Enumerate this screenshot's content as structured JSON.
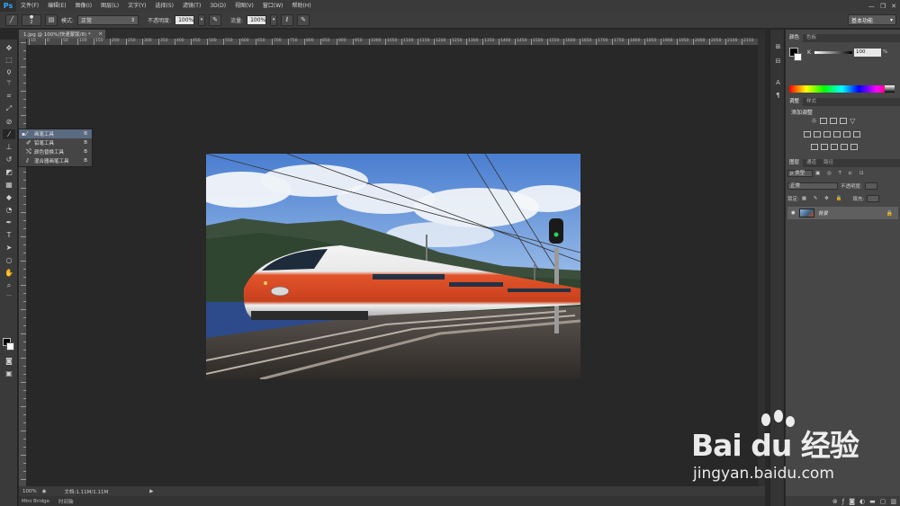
{
  "app": {
    "logo": "Ps"
  },
  "menu": [
    "文件(F)",
    "编辑(E)",
    "图像(I)",
    "图层(L)",
    "文字(Y)",
    "选择(S)",
    "滤镜(T)",
    "3D(D)",
    "视图(V)",
    "窗口(W)",
    "帮助(H)"
  ],
  "window_controls": {
    "minimize": "—",
    "restore": "❐",
    "close": "✕"
  },
  "options": {
    "brush_size": "2",
    "mode_label": "模式:",
    "mode_value": "正常",
    "opacity_label": "不透明度:",
    "opacity_value": "100%",
    "flow_label": "流量:",
    "flow_value": "100%"
  },
  "workspace": "基本功能",
  "document": {
    "tab_title": "1.jpg @ 100%(快速蒙版/8) *",
    "close": "×"
  },
  "ruler_labels": [
    "10",
    "0",
    "50",
    "100",
    "150",
    "200",
    "250",
    "300",
    "350",
    "400",
    "450",
    "500",
    "550",
    "600",
    "650",
    "700",
    "750",
    "800",
    "850",
    "900",
    "950",
    "1000",
    "1050",
    "1100",
    "1150",
    "1200",
    "1250",
    "1300",
    "1350",
    "1400",
    "1450",
    "1500",
    "1550",
    "1600",
    "1650",
    "1700",
    "1750",
    "1800",
    "1850",
    "1900",
    "1950",
    "2000",
    "2050",
    "2100",
    "2150",
    "2200"
  ],
  "flyout": [
    {
      "label": "画笔工具",
      "key": "B",
      "selected": true
    },
    {
      "label": "铅笔工具",
      "key": "B",
      "selected": false
    },
    {
      "label": "颜色替换工具",
      "key": "B",
      "selected": false
    },
    {
      "label": "混合器画笔工具",
      "key": "B",
      "selected": false
    }
  ],
  "status": {
    "zoom": "100%",
    "doc_info": "文档:1.11M/1.11M",
    "arrow": "▶"
  },
  "bottom_tabs": [
    "Mini Bridge",
    "时间轴"
  ],
  "color_panel": {
    "tabs": [
      "颜色",
      "色板"
    ],
    "channel": "K",
    "value": "100",
    "unit": "%"
  },
  "adjustments_panel": {
    "tabs": [
      "调整",
      "样式"
    ],
    "title": "添加调整"
  },
  "layers_panel": {
    "tabs": [
      "图层",
      "通道",
      "路径"
    ],
    "kind_label": "ρ 类型",
    "blend_mode": "正常",
    "opacity_label": "不透明度:",
    "lock_label": "锁定:",
    "fill_label": "填充:",
    "layer_name": "背景",
    "lock_icon": "🔒"
  },
  "watermark": {
    "brand": "Bai du 经验",
    "url": "jingyan.baidu.com"
  },
  "colors": {
    "menubar": "#3a3a3a",
    "canvas": "#282828",
    "panel": "#474747",
    "accent_blue": "#31a8ff"
  }
}
